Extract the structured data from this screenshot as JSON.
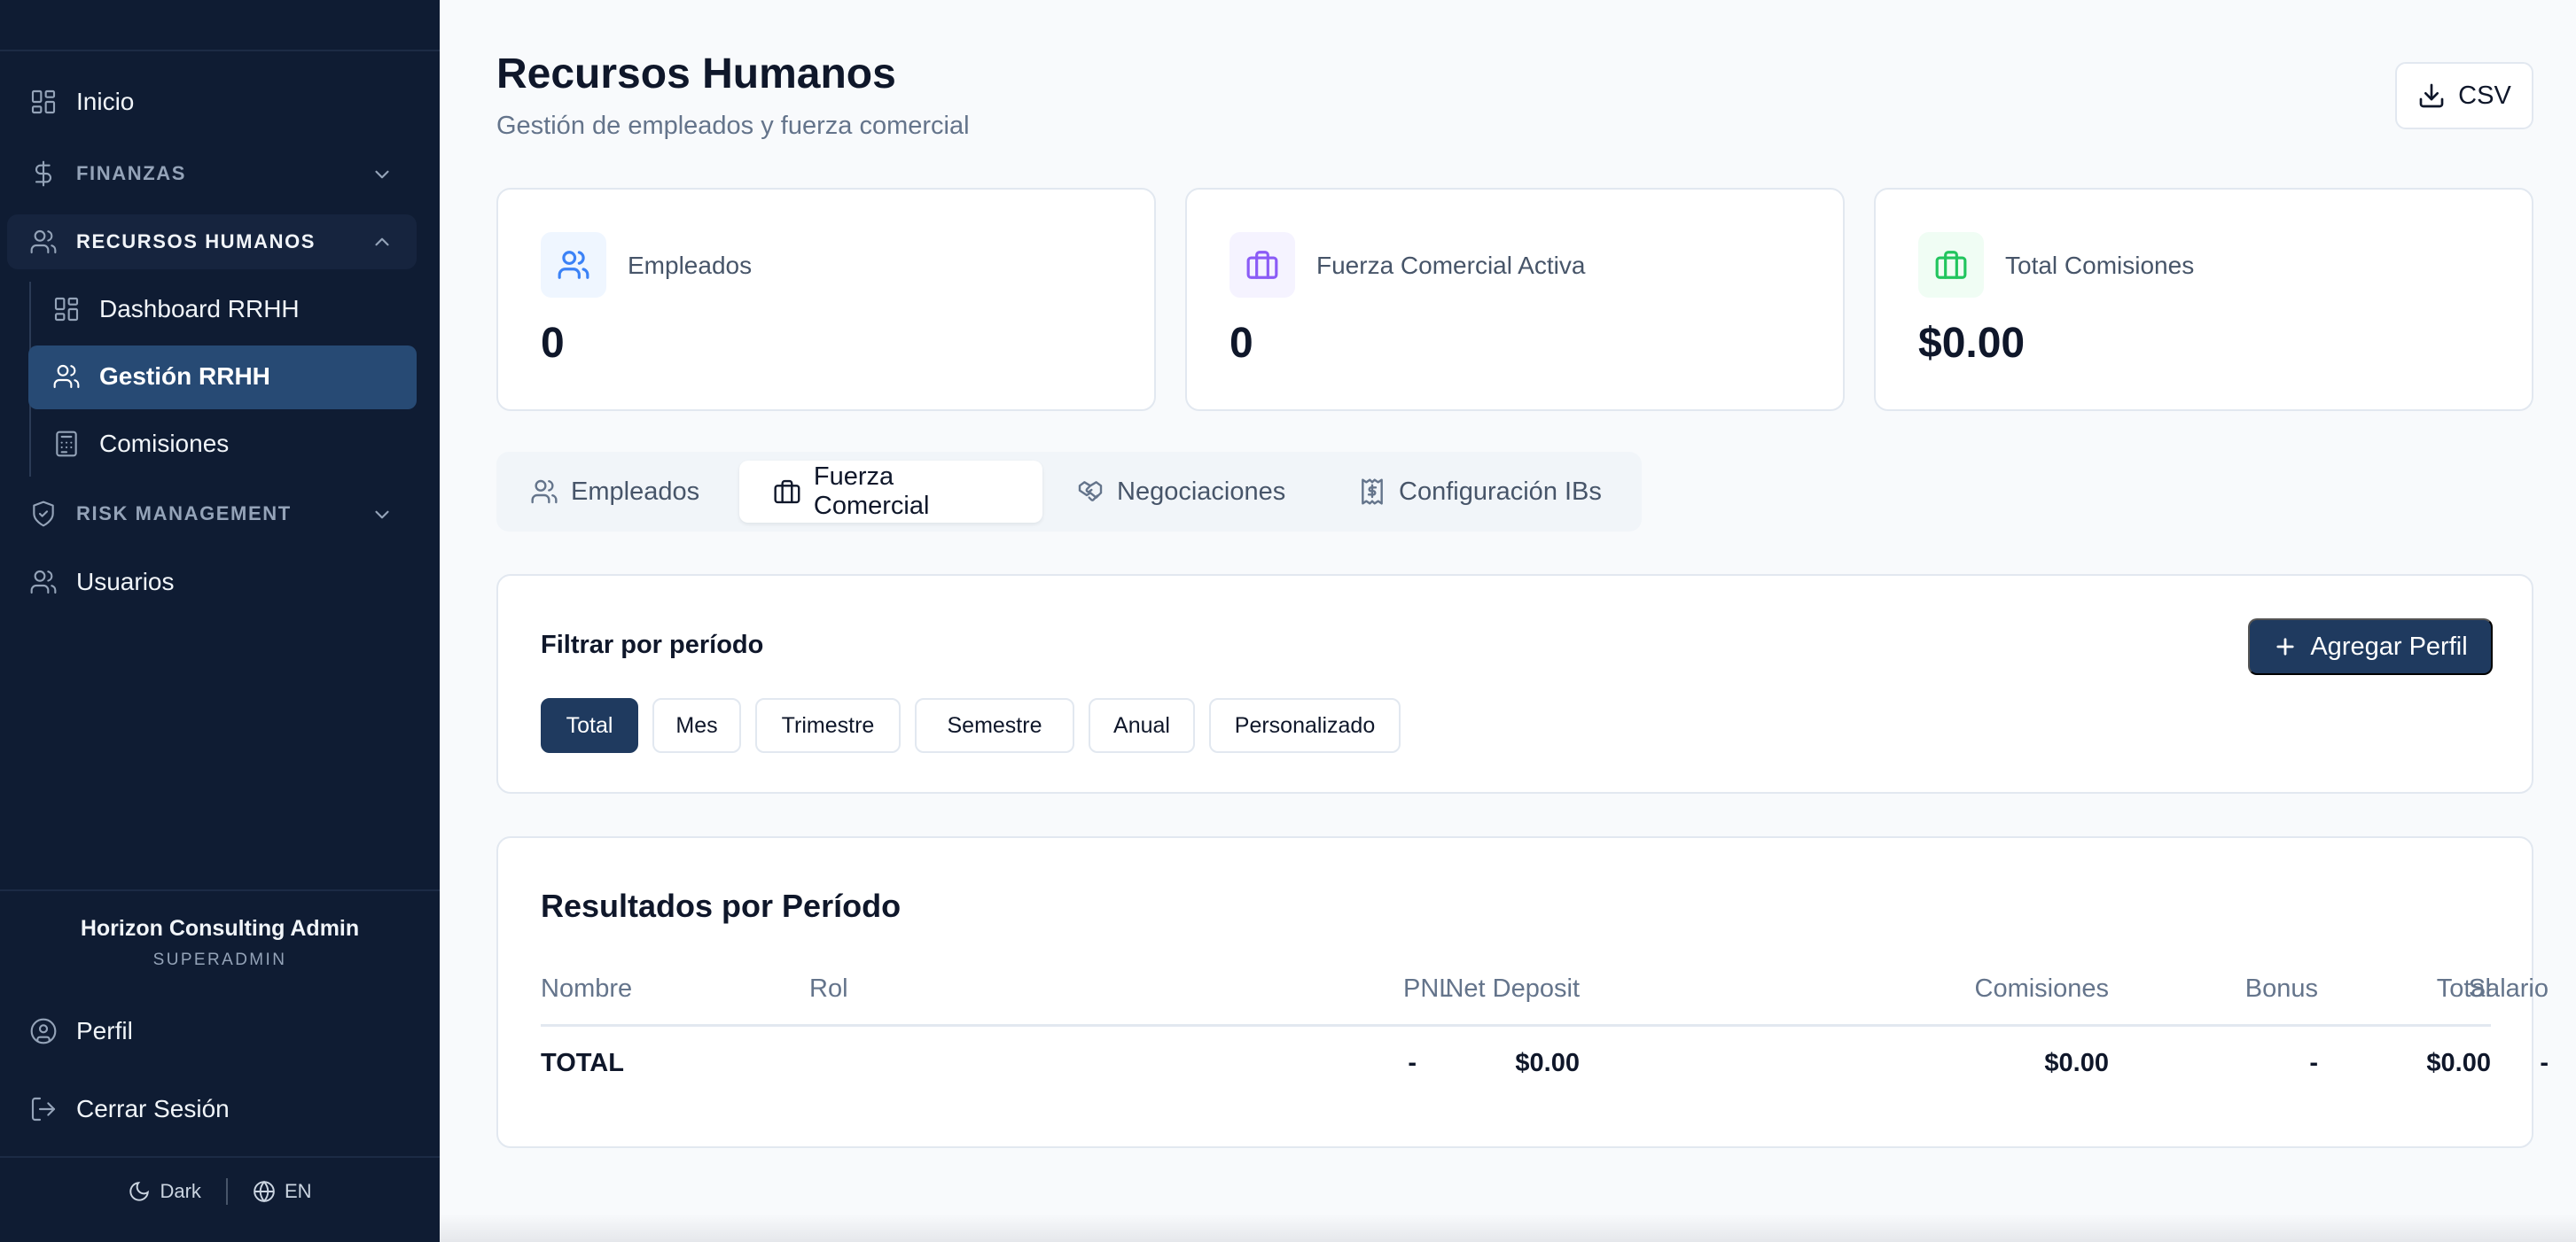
{
  "sidebar": {
    "items": [
      {
        "label": "Inicio",
        "icon": "dashboard-grid-icon"
      },
      {
        "label": "FINANZAS",
        "icon": "dollar-icon"
      },
      {
        "label": "RECURSOS HUMANOS",
        "icon": "users-icon"
      },
      {
        "label": "Dashboard RRHH",
        "icon": "dashboard-grid-icon"
      },
      {
        "label": "Gestión RRHH",
        "icon": "users-icon"
      },
      {
        "label": "Comisiones",
        "icon": "calculator-icon"
      },
      {
        "label": "RISK MANAGEMENT",
        "icon": "shield-icon"
      },
      {
        "label": "Usuarios",
        "icon": "users-icon"
      }
    ],
    "active_item": "Gestión RRHH",
    "user": {
      "name": "Horizon Consulting Admin",
      "role": "SUPERADMIN"
    },
    "perfil": "Perfil",
    "logout": "Cerrar Sesión",
    "theme": "Dark",
    "language": "EN"
  },
  "header": {
    "title": "Recursos Humanos",
    "subtitle": "Gestión de empleados y fuerza comercial",
    "csv_label": "CSV"
  },
  "stats": [
    {
      "label": "Empleados",
      "value": "0",
      "icon": "users-icon",
      "color": "#3b82f6",
      "bg": "#eff6ff"
    },
    {
      "label": "Fuerza Comercial Activa",
      "value": "0",
      "icon": "briefcase-icon",
      "color": "#8b5cf6",
      "bg": "#f5f3ff"
    },
    {
      "label": "Total Comisiones",
      "value": "$0.00",
      "icon": "briefcase-icon",
      "color": "#22c55e",
      "bg": "#f0fdf4"
    }
  ],
  "tabs": [
    {
      "label": "Empleados",
      "icon": "users-icon"
    },
    {
      "label": "Fuerza Comercial",
      "icon": "briefcase-icon",
      "active": true
    },
    {
      "label": "Negociaciones",
      "icon": "handshake-icon"
    },
    {
      "label": "Configuración IBs",
      "icon": "receipt-icon"
    }
  ],
  "filter": {
    "title": "Filtrar por período",
    "add_label": "Agregar Perfil",
    "periods": [
      "Total",
      "Mes",
      "Trimestre",
      "Semestre",
      "Anual",
      "Personalizado"
    ],
    "active_period": "Total"
  },
  "results": {
    "title": "Resultados por Período",
    "columns": [
      "Nombre",
      "Rol",
      "Net Deposit",
      "PNL",
      "Comisiones",
      "Bonus",
      "Salario",
      "Total"
    ],
    "total_row": [
      "TOTAL",
      "",
      "$0.00",
      "-",
      "$0.00",
      "-",
      "-",
      "$0.00"
    ]
  },
  "colors": {
    "sidebar_bg": "#0f1c33",
    "accent": "#1f3a5f",
    "active_item": "#274a74"
  }
}
